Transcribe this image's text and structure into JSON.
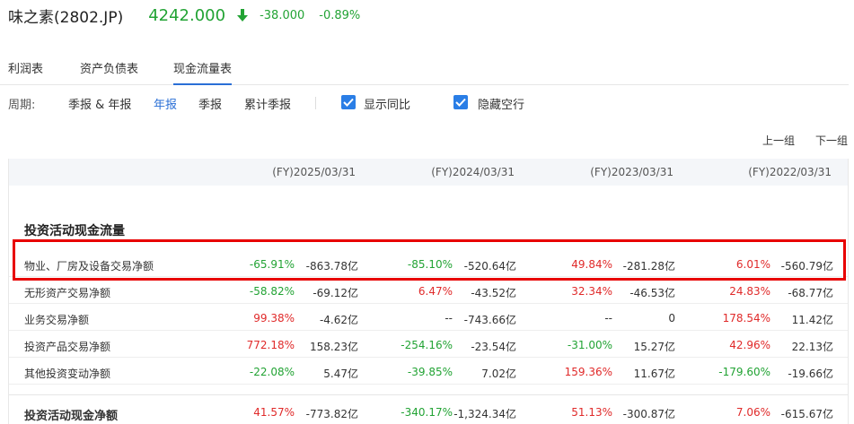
{
  "stock": {
    "name": "味之素(2802.JP)",
    "price": "4242.000",
    "change": "-38.000",
    "change_pct": "-0.89%",
    "trend_icon": "arrow-down-icon",
    "down_color": "#22a334",
    "up_color": "#e02a2a"
  },
  "tabs": [
    {
      "label": "利润表"
    },
    {
      "label": "资产负债表"
    },
    {
      "label": "现金流量表",
      "active": true
    }
  ],
  "filters": {
    "period_label": "周期:",
    "options": [
      "季报 & 年报",
      "年报",
      "季报",
      "累计季报"
    ],
    "active": "年报",
    "show_yoy": {
      "label": "显示同比",
      "checked": true
    },
    "hide_empty": {
      "label": "隐藏空行",
      "checked": true
    }
  },
  "pager": {
    "prev": "上一组",
    "next": "下一组"
  },
  "table": {
    "columns": [
      "(FY)2025/03/31",
      "(FY)2024/03/31",
      "(FY)2023/03/31",
      "(FY)2022/03/31"
    ],
    "section_title": "投资活动现金流量",
    "rows": [
      {
        "label": "物业、厂房及设备交易净额",
        "highlighted": true,
        "cells": [
          {
            "pct": "-65.91%",
            "dir": "down",
            "val": "-863.78亿"
          },
          {
            "pct": "-85.10%",
            "dir": "down",
            "val": "-520.64亿"
          },
          {
            "pct": "49.84%",
            "dir": "up",
            "val": "-281.28亿"
          },
          {
            "pct": "6.01%",
            "dir": "up",
            "val": "-560.79亿"
          }
        ]
      },
      {
        "label": "无形资产交易净额",
        "cells": [
          {
            "pct": "-58.82%",
            "dir": "down",
            "val": "-69.12亿"
          },
          {
            "pct": "6.47%",
            "dir": "up",
            "val": "-43.52亿"
          },
          {
            "pct": "32.34%",
            "dir": "up",
            "val": "-46.53亿"
          },
          {
            "pct": "24.83%",
            "dir": "up",
            "val": "-68.77亿"
          }
        ]
      },
      {
        "label": "业务交易净额",
        "cells": [
          {
            "pct": "99.38%",
            "dir": "up",
            "val": "-4.62亿"
          },
          {
            "pct": "--",
            "dir": "neutral",
            "val": "-743.66亿"
          },
          {
            "pct": "--",
            "dir": "neutral",
            "val": "0"
          },
          {
            "pct": "178.54%",
            "dir": "up",
            "val": "11.42亿"
          }
        ]
      },
      {
        "label": "投资产品交易净额",
        "cells": [
          {
            "pct": "772.18%",
            "dir": "up",
            "val": "158.23亿"
          },
          {
            "pct": "-254.16%",
            "dir": "down",
            "val": "-23.54亿"
          },
          {
            "pct": "-31.00%",
            "dir": "down",
            "val": "15.27亿"
          },
          {
            "pct": "42.96%",
            "dir": "up",
            "val": "22.13亿"
          }
        ]
      },
      {
        "label": "其他投资变动净额",
        "cells": [
          {
            "pct": "-22.08%",
            "dir": "down",
            "val": "5.47亿"
          },
          {
            "pct": "-39.85%",
            "dir": "down",
            "val": "7.02亿"
          },
          {
            "pct": "159.36%",
            "dir": "up",
            "val": "11.67亿"
          },
          {
            "pct": "-179.60%",
            "dir": "down",
            "val": "-19.66亿"
          }
        ]
      },
      {
        "label": "投资活动现金净额",
        "total": true,
        "cells": [
          {
            "pct": "41.57%",
            "dir": "up",
            "val": "-773.82亿"
          },
          {
            "pct": "-340.17%",
            "dir": "down",
            "val": "-1,324.34亿"
          },
          {
            "pct": "51.13%",
            "dir": "up",
            "val": "-300.87亿"
          },
          {
            "pct": "7.06%",
            "dir": "up",
            "val": "-615.67亿"
          }
        ]
      }
    ]
  }
}
